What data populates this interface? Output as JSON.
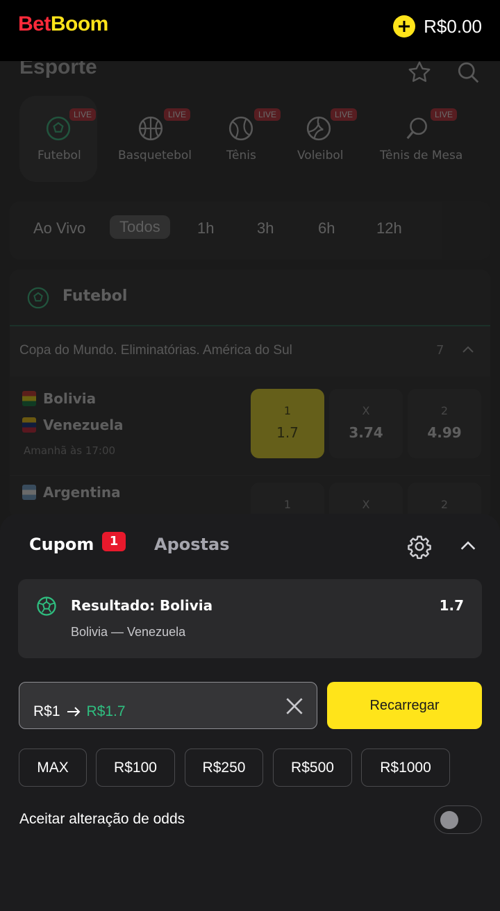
{
  "header": {
    "logo_part1": "Bet",
    "logo_part2": "Boom",
    "balance": "R$0.00"
  },
  "page": {
    "title": "Esporte",
    "sports": [
      {
        "label": "Futebol",
        "live": "LIVE",
        "icon": "soccer-ball-icon"
      },
      {
        "label": "Basquetebol",
        "live": "LIVE",
        "icon": "basketball-icon"
      },
      {
        "label": "Tênis",
        "live": "LIVE",
        "icon": "tennis-ball-icon"
      },
      {
        "label": "Voleibol",
        "live": "LIVE",
        "icon": "volleyball-icon"
      },
      {
        "label": "Tênis de Mesa",
        "live": "LIVE",
        "icon": "table-tennis-icon"
      }
    ],
    "time_filters": [
      "Ao Vivo",
      "Todos",
      "1h",
      "3h",
      "6h",
      "12h"
    ],
    "selected_time_filter": "Todos",
    "section": "Futebol",
    "league": {
      "name": "Copa do Mundo. Eliminatórias. América do Sul",
      "count": "7"
    },
    "matches": [
      {
        "team1": "Bolivia",
        "team2": "Venezuela",
        "time": "Amanhã às 17:00",
        "odds": [
          {
            "key": "1",
            "value": "1.7"
          },
          {
            "key": "X",
            "value": "3.74"
          },
          {
            "key": "2",
            "value": "4.99"
          }
        ]
      },
      {
        "team1": "Argentina",
        "odds": [
          {
            "key": "1"
          },
          {
            "key": "X"
          },
          {
            "key": "2"
          }
        ]
      }
    ]
  },
  "coupon": {
    "tab_cupom": "Cupom",
    "badge": "1",
    "tab_apostas": "Apostas",
    "bet": {
      "title": "Resultado: Bolivia",
      "odd": "1.7",
      "event": "Bolivia — Venezuela"
    },
    "stake": "R$1",
    "potential_win": "R$1.7",
    "recharge_label": "Recarregar",
    "quick_amounts": [
      "MAX",
      "R$100",
      "R$250",
      "R$500",
      "R$1000"
    ],
    "accept_odds_label": "Aceitar alteração de odds",
    "accept_odds_enabled": false
  },
  "colors": {
    "brand_red": "#ff2a3a",
    "brand_yellow": "#ffe41a",
    "win_green": "#2fbf80",
    "badge_red": "#e8192c"
  }
}
